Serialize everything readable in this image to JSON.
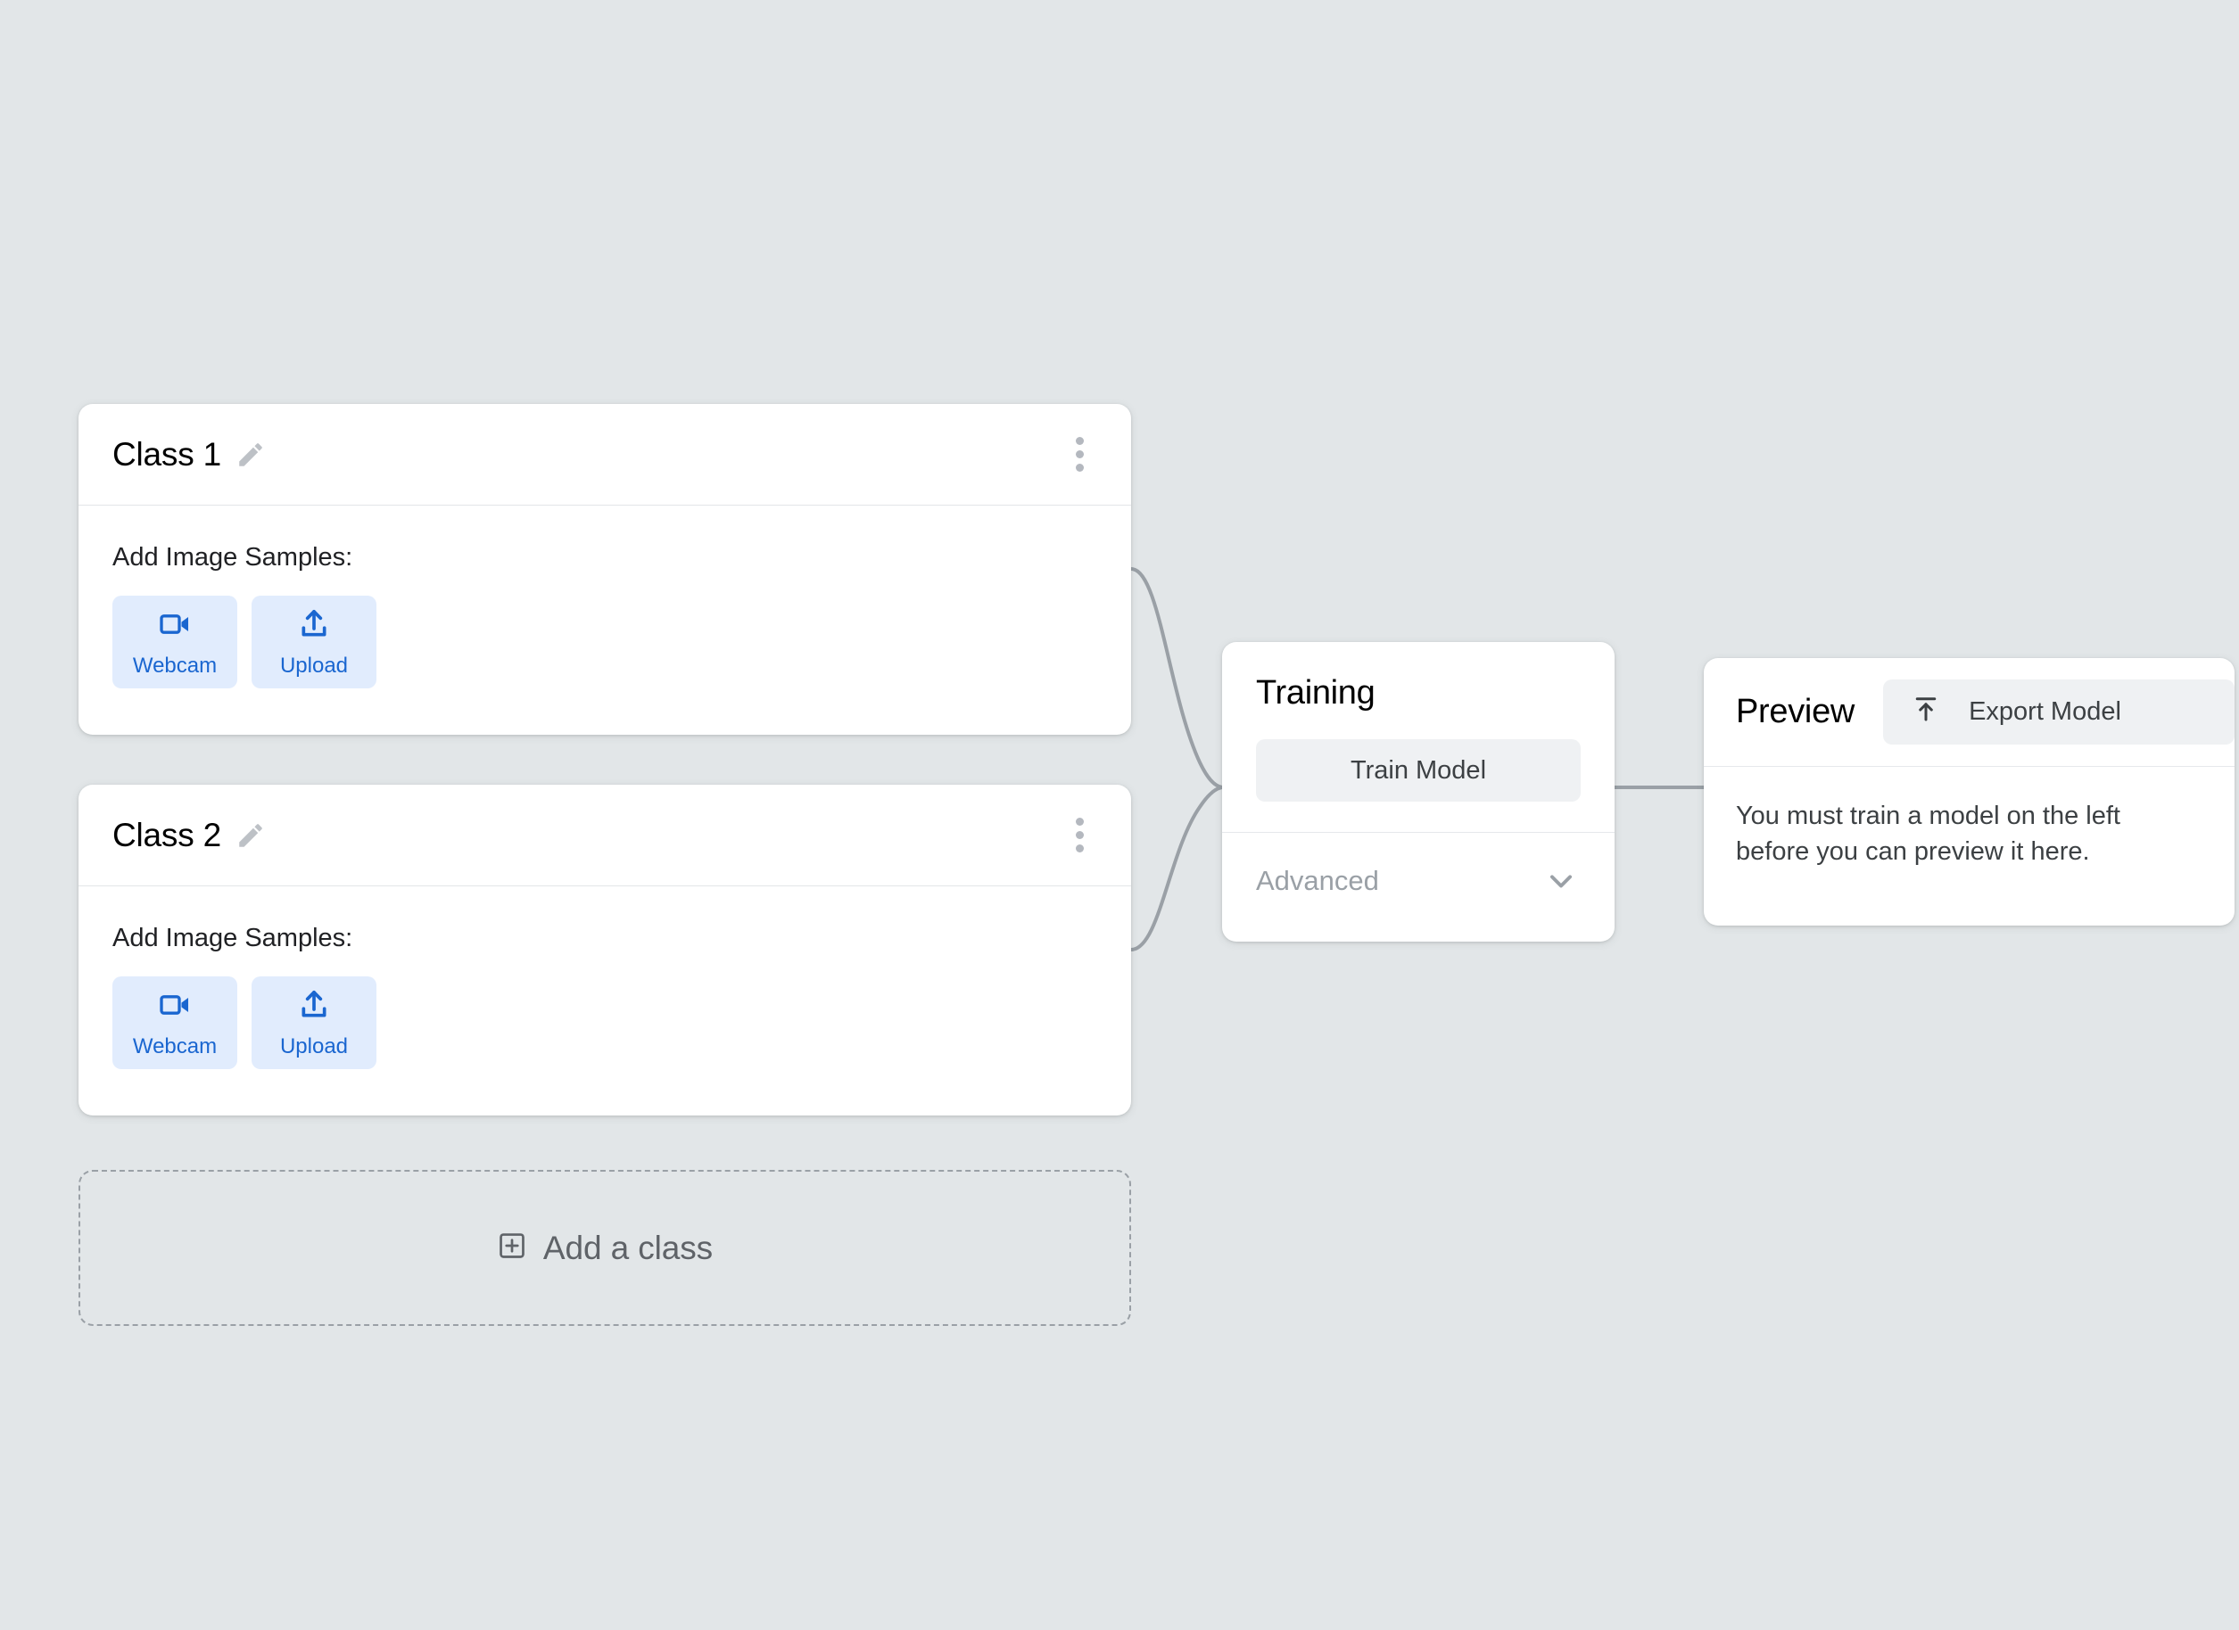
{
  "theme": {
    "background": "#e2e6e8",
    "card_bg": "#ffffff",
    "accent_blue": "#1a66d0",
    "accent_blue_bg": "#e1ecfd",
    "muted_text": "#9aa0a6",
    "button_bg": "#eff1f3",
    "connector_line": "#9aa0a6"
  },
  "classes": [
    {
      "title": "Class 1",
      "edit_icon": "pencil-icon",
      "menu_icon": "more-vertical-icon",
      "samples_label": "Add Image Samples:",
      "buttons": [
        {
          "label": "Webcam",
          "icon": "videocam-icon"
        },
        {
          "label": "Upload",
          "icon": "upload-icon"
        }
      ]
    },
    {
      "title": "Class 2",
      "edit_icon": "pencil-icon",
      "menu_icon": "more-vertical-icon",
      "samples_label": "Add Image Samples:",
      "buttons": [
        {
          "label": "Webcam",
          "icon": "videocam-icon"
        },
        {
          "label": "Upload",
          "icon": "upload-icon"
        }
      ]
    }
  ],
  "add_class": {
    "label": "Add a class",
    "icon": "add-box-icon"
  },
  "training": {
    "title": "Training",
    "train_button_label": "Train Model",
    "advanced_label": "Advanced",
    "advanced_icon": "chevron-down-icon"
  },
  "preview": {
    "title": "Preview",
    "export_button_label": "Export Model",
    "export_icon": "export-upload-icon",
    "message": "You must train a model on the left before you can preview it here."
  }
}
